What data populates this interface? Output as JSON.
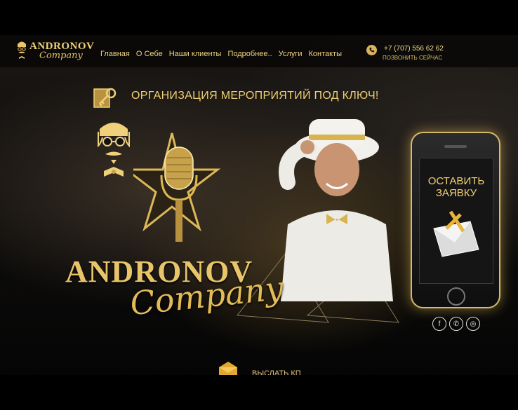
{
  "header": {
    "logo_text": "ANDRONOV",
    "logo_script": "Company",
    "nav": [
      "Главная",
      "О Себе",
      "Наши клиенты",
      "Подробнее..",
      "Услуги",
      "Контакты"
    ],
    "phone": "+7 (707) 556 62 62",
    "call_now": "ПОЗВОНИТЬ СЕЙЧАС"
  },
  "hero": {
    "tagline": "ОРГАНИЗАЦИЯ МЕРОПРИЯТИЙ ПОД КЛЮЧ!",
    "brand_big": "ANDRONOV",
    "brand_script": "Company"
  },
  "cta": {
    "line1": "ОСТАВИТЬ",
    "line2": "ЗАЯВКУ"
  },
  "footer": {
    "send_label": "ВЫСЛАТЬ КП"
  },
  "socials": [
    "facebook-icon",
    "whatsapp-icon",
    "instagram-icon"
  ],
  "colors": {
    "gold": "#e8c56a",
    "background": "#0d0c0b"
  }
}
